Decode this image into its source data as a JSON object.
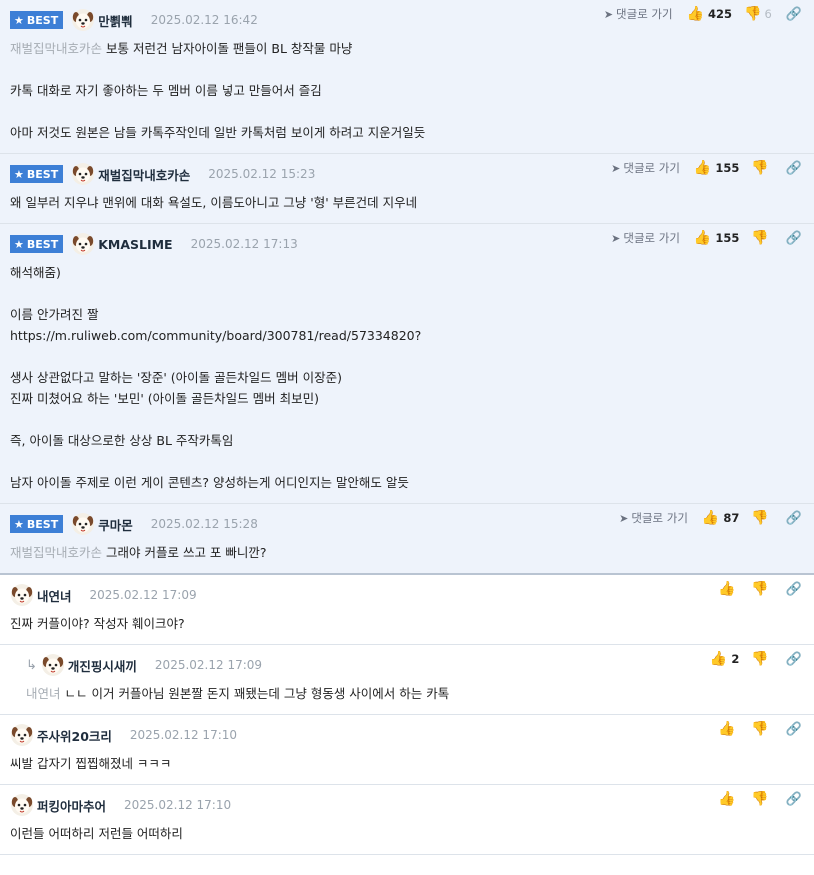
{
  "labels": {
    "best": "BEST",
    "goto": "댓글로 가기"
  },
  "comments": [
    {
      "best": true,
      "nick": "만뾝뿨",
      "time": "2025.02.12 16:42",
      "likes": "425",
      "dislikes": "6",
      "mention": "재벌집막내호카손",
      "lines": [
        "보통 저런건 남자아이돌 팬들이 BL 창작물 마냥",
        "",
        "카톡 대화로 자기 좋아하는 두 멤버 이름 넣고 만들어서 즐김",
        "",
        "아마 저것도 원본은 남들 카톡주작인데 일반 카톡처럼 보이게 하려고 지운거일듯"
      ]
    },
    {
      "best": true,
      "nick": "재벌집막내호카손",
      "time": "2025.02.12 15:23",
      "likes": "155",
      "dislikes": "",
      "mention": "",
      "lines": [
        "왜 일부러 지우냐 맨위에 대화 욕설도, 이름도아니고 그냥 '형' 부른건데 지우네"
      ]
    },
    {
      "best": true,
      "nick": "KMASLIME",
      "time": "2025.02.12 17:13",
      "likes": "155",
      "dislikes": "",
      "mention": "",
      "lines": [
        "해석해줌)",
        "",
        "이름 안가려진 짤",
        "https://m.ruliweb.com/community/board/300781/read/57334820?",
        "",
        "생사 상관없다고 말하는 '장준' (아이돌 골든차일드 멤버 이장준)",
        "진짜 미쳤어요 하는 '보민' (아이돌 골든차일드 멤버 최보민)",
        "",
        "즉, 아이돌 대상으로한 상상 BL 주작카톡임",
        "",
        "남자 아이돌 주제로 이런 게이 콘텐츠? 양성하는게 어디인지는 말안해도 알듯"
      ]
    },
    {
      "best": true,
      "nick": "쿠마몬",
      "time": "2025.02.12 15:28",
      "likes": "87",
      "dislikes": "",
      "mention": "재벌집막내호카손",
      "lines": [
        "그래야 커플로 쓰고 포 빠니깐?"
      ]
    },
    {
      "best": false,
      "nick": "내연녀",
      "time": "2025.02.12 17:09",
      "likes": "",
      "dislikes": "",
      "mention": "",
      "lines": [
        "진짜 커플이야? 작성자 훼이크야?"
      ]
    },
    {
      "best": false,
      "reply": true,
      "nick": "개진핑시새끼",
      "time": "2025.02.12 17:09",
      "likes": "2",
      "dislikes": "",
      "mention": "내연녀",
      "lines": [
        "ㄴㄴ 이거 커플아님 원본짤 돈지 꽤됐는데 그냥 형동생 사이에서 하는 카톡"
      ]
    },
    {
      "best": false,
      "nick": "주사위20크리",
      "time": "2025.02.12 17:10",
      "likes": "",
      "dislikes": "",
      "mention": "",
      "lines": [
        "씨발 갑자기 찝찝해졌네 ㅋㅋㅋ"
      ]
    },
    {
      "best": false,
      "nick": "퍼킹아마추어",
      "time": "2025.02.12 17:10",
      "likes": "",
      "dislikes": "",
      "mention": "",
      "lines": [
        "이런들 어떠하리 저런들 어떠하리"
      ]
    }
  ]
}
